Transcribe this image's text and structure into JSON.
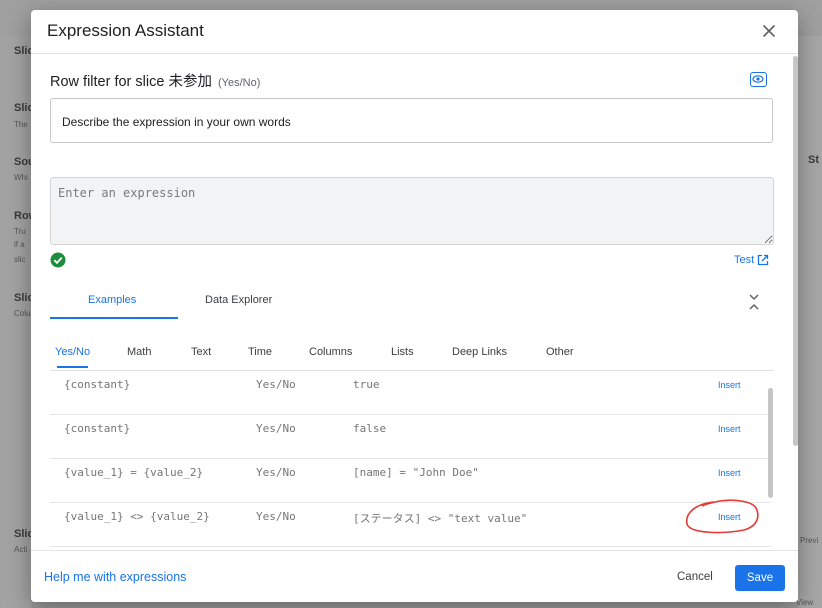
{
  "background": {
    "left_labels": [
      "Slic",
      "Slic",
      "The",
      "Sou",
      "Whi",
      "Row",
      "Tru",
      "if a",
      "slic",
      "Slic",
      "Colu",
      "Slic",
      "Acti"
    ],
    "right_labels": [
      "St",
      "Previ",
      "View"
    ]
  },
  "dialog": {
    "title": "Expression Assistant",
    "row_filter_label": "Row filter for slice 未参加",
    "row_filter_hint": "(Yes/No)",
    "describe_text": "Describe the expression in your own words",
    "expression_placeholder": "Enter an expression",
    "test_label": "Test"
  },
  "main_tabs": [
    {
      "label": "Examples",
      "active": true
    },
    {
      "label": "Data Explorer",
      "active": false
    }
  ],
  "sub_tabs": [
    {
      "label": "Yes/No",
      "active": true
    },
    {
      "label": "Math"
    },
    {
      "label": "Text"
    },
    {
      "label": "Time"
    },
    {
      "label": "Columns"
    },
    {
      "label": "Lists"
    },
    {
      "label": "Deep Links"
    },
    {
      "label": "Other"
    }
  ],
  "examples": [
    {
      "syntax": "{constant}",
      "type": "Yes/No",
      "example": "true",
      "action": "Insert"
    },
    {
      "syntax": "{constant}",
      "type": "Yes/No",
      "example": "false",
      "action": "Insert"
    },
    {
      "syntax": "{value_1} = {value_2}",
      "type": "Yes/No",
      "example": "[name] = \"John Doe\"",
      "action": "Insert"
    },
    {
      "syntax": "{value_1} <> {value_2}",
      "type": "Yes/No",
      "example": "[ステータス] <> \"text value\"",
      "action": "Insert"
    }
  ],
  "footer": {
    "help_label": "Help me with expressions",
    "cancel_label": "Cancel",
    "save_label": "Save"
  },
  "colors": {
    "accent": "#1a73e8",
    "annotation": "#e53935",
    "success": "#1e8e3e"
  },
  "icons": [
    "close-icon",
    "eye-icon",
    "check-circle-icon",
    "open-in-new-icon",
    "collapse-icon"
  ]
}
